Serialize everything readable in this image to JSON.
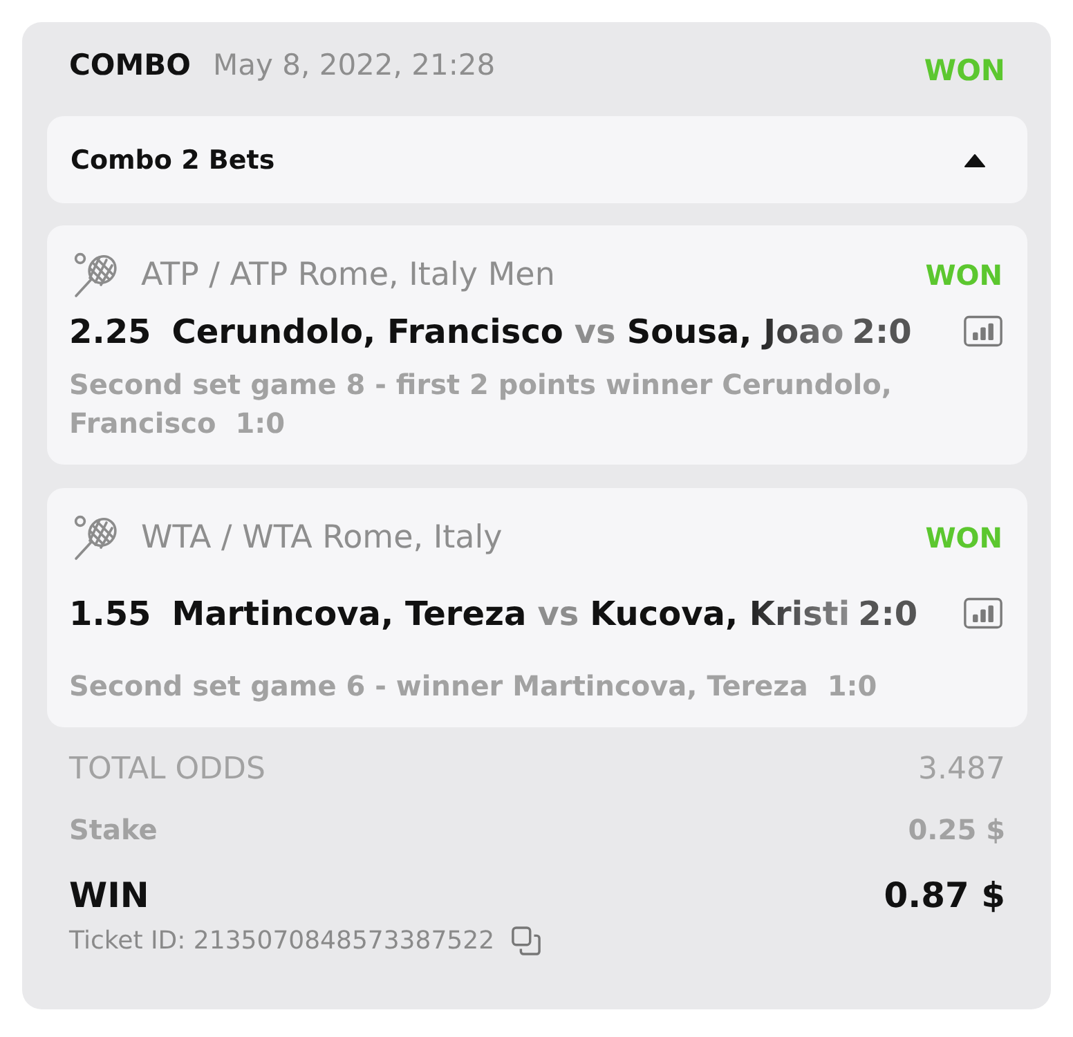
{
  "header": {
    "type": "COMBO",
    "date": "May 8, 2022, 21:28",
    "status": "WON"
  },
  "combo_panel": {
    "label": "Combo 2 Bets",
    "expanded": true
  },
  "bets": [
    {
      "league": "ATP / ATP Rome, Italy Men",
      "status": "WON",
      "odds": "2.25",
      "team1": "Cerundolo, Francisco",
      "vs": "vs",
      "team2": "Sousa, Joao",
      "score": "2:0",
      "market": "Second set game 8 - first 2 points winner Cerundolo, Francisco",
      "market_score": "1:0"
    },
    {
      "league": "WTA / WTA Rome, Italy",
      "status": "WON",
      "odds": "1.55",
      "team1": "Martincova, Tereza",
      "vs": "vs",
      "team2": "Kucova, Kristi",
      "score": "2:0",
      "market": "Second set game 6 - winner Martincova, Tereza",
      "market_score": "1:0"
    }
  ],
  "totals": [
    {
      "kind": "odds",
      "label": "TOTAL ODDS",
      "value": "3.487"
    },
    {
      "kind": "stake",
      "label": "Stake",
      "value": "0.25 $"
    },
    {
      "kind": "win",
      "label": "WIN",
      "value": "0.87 $"
    }
  ],
  "ticket": {
    "label": "Ticket ID: 2135070848573387522"
  }
}
